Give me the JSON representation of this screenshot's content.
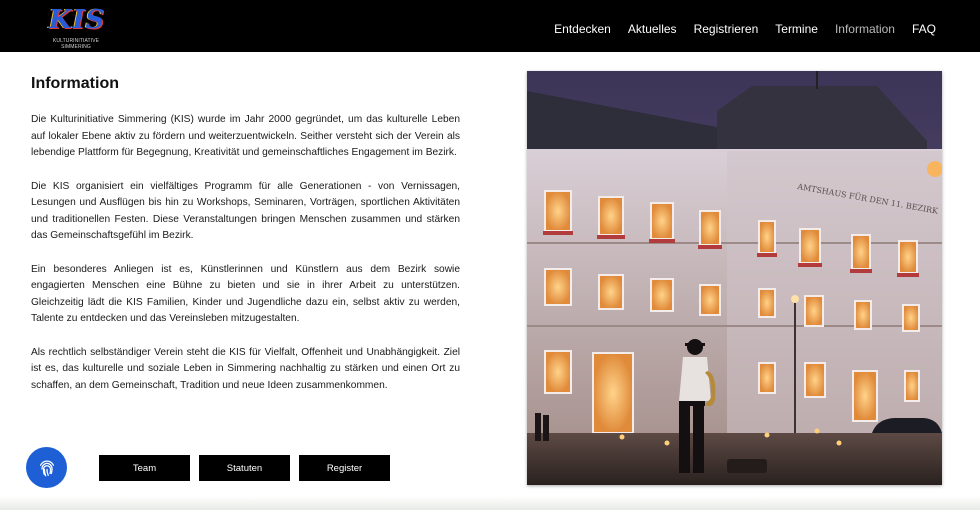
{
  "header": {
    "logo_text": "KIS",
    "logo_subtitle": "KULTURINITIATIVE SIMMERING",
    "nav": [
      {
        "label": "Entdecken",
        "active": false
      },
      {
        "label": "Aktuelles",
        "active": false
      },
      {
        "label": "Registrieren",
        "active": false
      },
      {
        "label": "Termine",
        "active": false
      },
      {
        "label": "Information",
        "active": true
      },
      {
        "label": "FAQ",
        "active": false
      }
    ]
  },
  "main": {
    "title": "Information",
    "paragraphs": [
      "Die Kulturinitiative Simmering (KIS) wurde im Jahr 2000 gegründet, um das kulturelle Leben auf lokaler Ebene aktiv zu fördern und weiterzuentwickeln. Seither versteht sich der Verein als lebendige Plattform für Begegnung, Kreativität und gemeinschaftliches Engagement im Bezirk.",
      "Die KIS organisiert ein vielfältiges Programm für alle Generationen - von Vernissagen, Lesungen und Ausflügen bis hin zu Workshops, Seminaren, Vorträgen, sportlichen Aktivitäten und traditionellen Festen. Diese Veranstaltungen bringen Menschen zusammen und stärken das Gemeinschaftsgefühl im Bezirk.",
      "Ein besonderes Anliegen ist es, Künstlerinnen und Künstlern aus dem Bezirk sowie engagierten Menschen eine Bühne zu bieten und sie in ihrer Arbeit zu unterstützen. Gleichzeitig lädt die KIS Familien, Kinder und Jugendliche dazu ein, selbst aktiv zu werden, Talente zu entdecken und das Vereinsleben mitzugestalten.",
      "Als rechtlich selbständiger Verein steht die KIS für Vielfalt, Offenheit und Unabhängigkeit. Ziel ist es, das kulturelle und soziale Leben in Simmering nachhaltig zu stärken und einen Ort zu schaffen, an dem Gemeinschaft, Tradition und neue Ideen zusammenkommen."
    ],
    "buttons": [
      "Team",
      "Statuten",
      "Register"
    ],
    "building_sign": "AMTSHAUS FÜR DEN 11. BEZIRK"
  },
  "icons": {
    "fingerprint": "fingerprint-icon"
  },
  "colors": {
    "header_bg": "#000000",
    "button_bg": "#000000",
    "accent_blue": "#1e5fd6",
    "active_nav": "#b9b9b9"
  }
}
